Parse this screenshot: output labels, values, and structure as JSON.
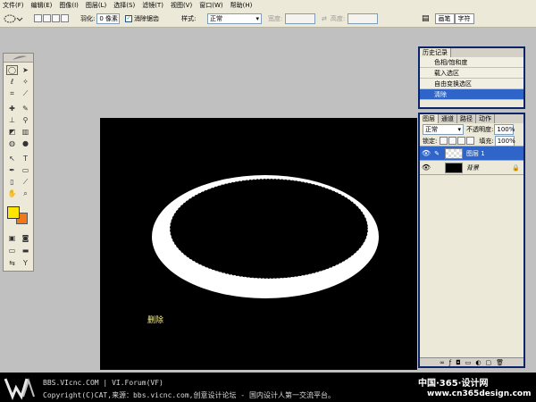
{
  "menu": [
    "文件(F)",
    "编辑(E)",
    "图像(I)",
    "图层(L)",
    "选择(S)",
    "滤镜(T)",
    "视图(V)",
    "窗口(W)",
    "帮助(H)"
  ],
  "options": {
    "feather_label": "羽化:",
    "feather_value": "0 像素",
    "antialias_label": "消除锯齿",
    "style_label": "样式:",
    "style_value": "正常",
    "width_label": "宽度:",
    "height_label": "高度:",
    "tab_brush": "画笔",
    "tab_char": "字符"
  },
  "document": {
    "caption": "删除"
  },
  "history": {
    "tab": "历史记录",
    "items": [
      "色相/饱和度",
      "载入选区",
      "自由变换选区",
      "清除"
    ]
  },
  "layers": {
    "tabs": [
      "图层",
      "通道",
      "路径",
      "动作"
    ],
    "blend": "正常",
    "opacity_label": "不透明度:",
    "opacity": "100%",
    "lock_label": "锁定:",
    "fill_label": "填充:",
    "fill": "100%",
    "items": [
      {
        "name": "图层 1",
        "active": true
      },
      {
        "name": "背景",
        "active": false
      }
    ]
  },
  "colors": {
    "foreground": "#ffe600",
    "background": "#f07818",
    "selection": "#2f65c8"
  },
  "icons": [
    "marquee-icon",
    "move-icon",
    "lasso-icon",
    "wand-icon",
    "crop-icon",
    "eye-icon",
    "lock-icon"
  ],
  "footer": {
    "line1": "BBS.VIcnc.COM | VI.Forum(VF)",
    "line2": "Copyright(C)CAT,来源：bbs.vicnc.com,创意设计论坛 - 国内设计人第一交流平台。",
    "watermark1": "中国·365·设计网",
    "watermark2": "www.cn365design.com"
  }
}
